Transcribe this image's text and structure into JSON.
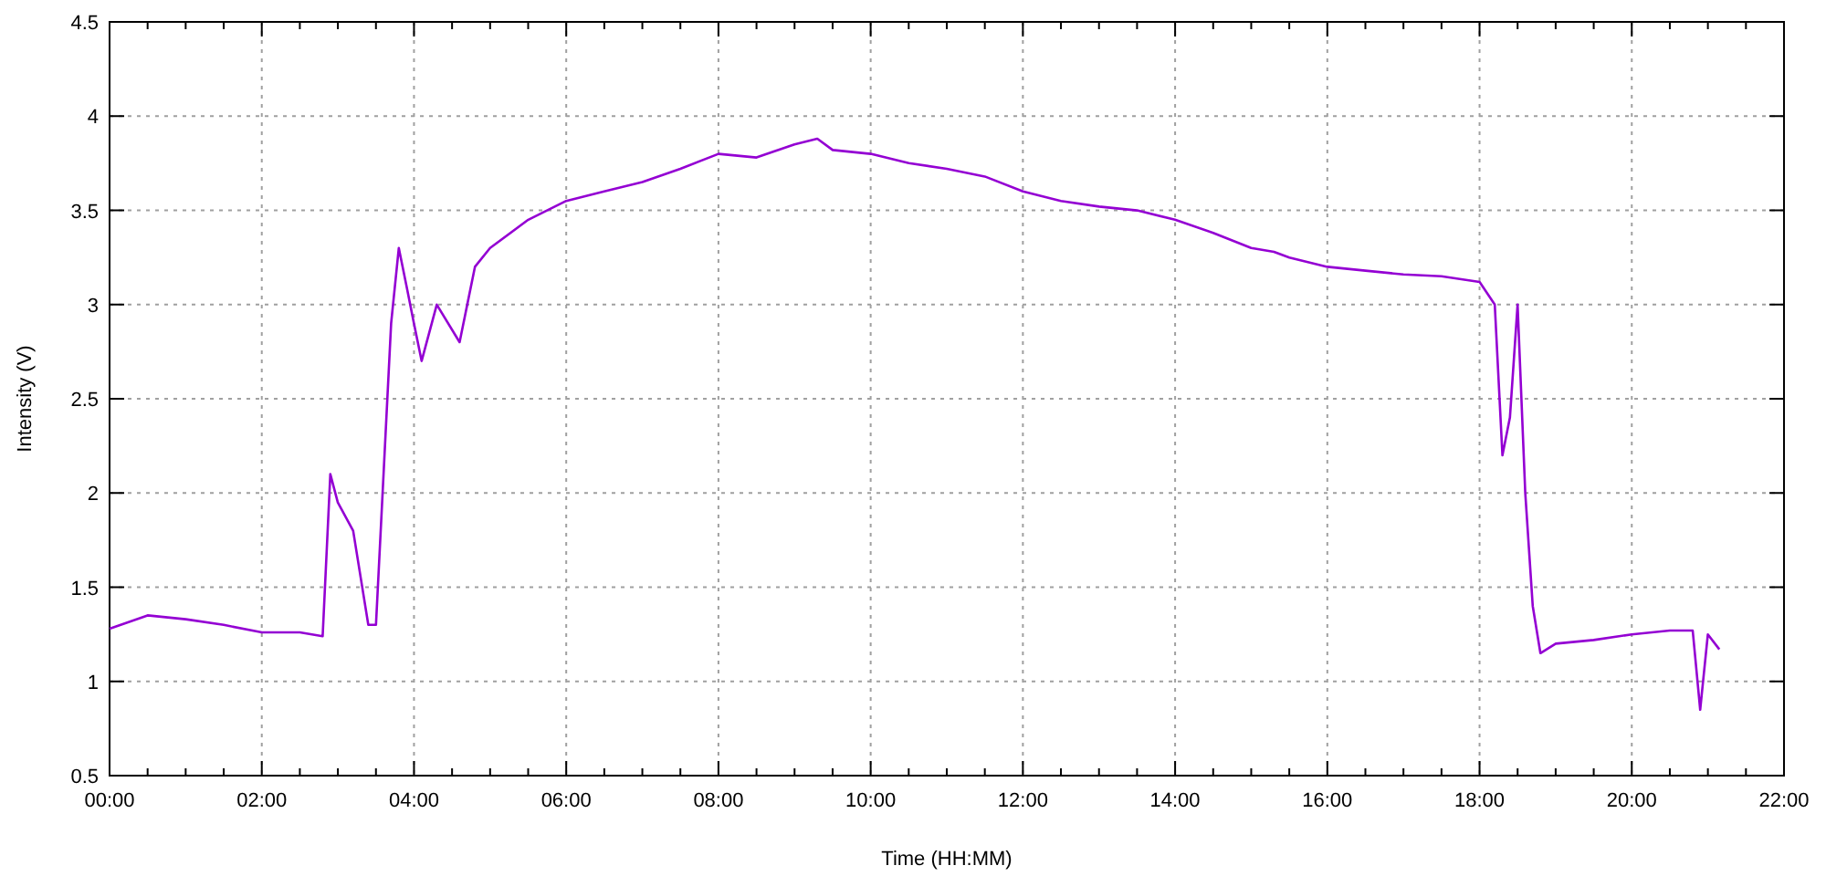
{
  "chart_data": {
    "type": "line",
    "grid": true,
    "xlabel": "Time (HH:MM)",
    "ylabel": "Intensity (V)",
    "xlim": [
      0,
      22
    ],
    "ylim": [
      0.5,
      4.5
    ],
    "xticks": [
      {
        "value": 0,
        "label": "00:00"
      },
      {
        "value": 2,
        "label": "02:00"
      },
      {
        "value": 4,
        "label": "04:00"
      },
      {
        "value": 6,
        "label": "06:00"
      },
      {
        "value": 8,
        "label": "08:00"
      },
      {
        "value": 10,
        "label": "10:00"
      },
      {
        "value": 12,
        "label": "12:00"
      },
      {
        "value": 14,
        "label": "14:00"
      },
      {
        "value": 16,
        "label": "16:00"
      },
      {
        "value": 18,
        "label": "18:00"
      },
      {
        "value": 20,
        "label": "20:00"
      },
      {
        "value": 22,
        "label": "22:00"
      }
    ],
    "yticks": [
      {
        "value": 0.5,
        "label": "0.5"
      },
      {
        "value": 1,
        "label": "1"
      },
      {
        "value": 1.5,
        "label": "1.5"
      },
      {
        "value": 2,
        "label": "2"
      },
      {
        "value": 2.5,
        "label": "2.5"
      },
      {
        "value": 3,
        "label": "3"
      },
      {
        "value": 3.5,
        "label": "3.5"
      },
      {
        "value": 4,
        "label": "4"
      },
      {
        "value": 4.5,
        "label": "4.5"
      }
    ],
    "x": [
      0,
      0.5,
      1,
      1.5,
      2,
      2.5,
      2.8,
      2.9,
      3,
      3.2,
      3.4,
      3.5,
      3.7,
      3.8,
      3.9,
      4,
      4.1,
      4.3,
      4.6,
      4.8,
      5,
      5.5,
      6,
      6.5,
      7,
      7.5,
      8,
      8.5,
      9,
      9.3,
      9.5,
      10,
      10.5,
      11,
      11.5,
      12,
      12.5,
      13,
      13.5,
      14,
      14.5,
      15,
      15.3,
      15.5,
      16,
      16.5,
      17,
      17.5,
      18,
      18.2,
      18.3,
      18.4,
      18.5,
      18.6,
      18.7,
      18.8,
      19,
      19.5,
      20,
      20.5,
      20.8,
      20.9,
      21,
      21.15
    ],
    "series": [
      {
        "color": "#9400d3",
        "values": [
          1.28,
          1.35,
          1.33,
          1.3,
          1.26,
          1.26,
          1.24,
          2.1,
          1.95,
          1.8,
          1.3,
          1.3,
          2.9,
          3.3,
          3.1,
          2.9,
          2.7,
          3,
          2.8,
          3.2,
          3.3,
          3.45,
          3.55,
          3.6,
          3.65,
          3.72,
          3.8,
          3.78,
          3.85,
          3.88,
          3.82,
          3.8,
          3.75,
          3.72,
          3.68,
          3.6,
          3.55,
          3.52,
          3.5,
          3.45,
          3.38,
          3.3,
          3.28,
          3.25,
          3.2,
          3.18,
          3.16,
          3.15,
          3.12,
          3,
          2.2,
          2.4,
          3,
          2,
          1.4,
          1.15,
          1.2,
          1.22,
          1.25,
          1.27,
          1.27,
          0.85,
          1.25,
          1.17
        ]
      }
    ]
  }
}
